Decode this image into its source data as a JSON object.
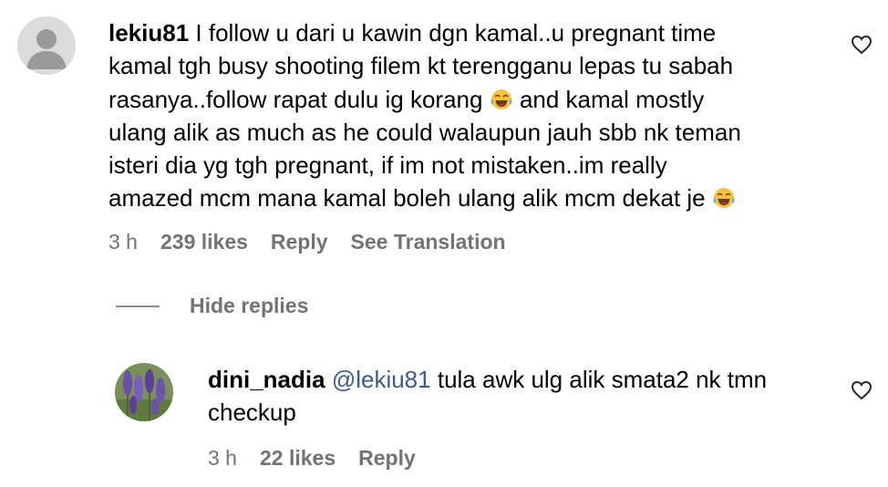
{
  "comment": {
    "username": "lekiu81",
    "lines": [
      "I follow u dari u kawin dgn kamal..u pregnant time",
      "kamal tgh busy shooting filem kt terengganu lepas tu sabah",
      "rasanya..follow rapat dulu ig korang",
      "and kamal mostly",
      "ulang alik as much as he could walaupun jauh sbb nk teman",
      "isteri dia yg tgh pregnant, if im not mistaken..im really",
      "amazed mcm mana kamal boleh ulang alik mcm dekat je"
    ],
    "emoji_icon": "face-with-tears-of-joy-icon",
    "time": "3 h",
    "likes": "239 likes",
    "reply_label": "Reply",
    "translate_label": "See Translation"
  },
  "hide_replies_label": "Hide replies",
  "reply": {
    "username": "dini_nadia",
    "mention": "@lekiu81",
    "text_line1": "tula awk ulg alik smata2 nk tmn",
    "text_line2": "checkup",
    "time": "3 h",
    "likes": "22 likes",
    "reply_label": "Reply"
  },
  "colors": {
    "meta_gray": "#737373",
    "mention_blue": "#3b5b8f",
    "avatar_gray": "#c7c7c7"
  }
}
